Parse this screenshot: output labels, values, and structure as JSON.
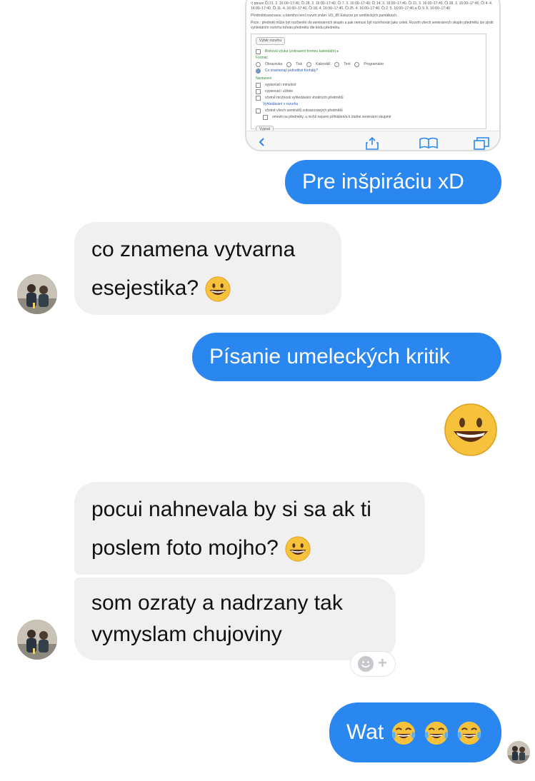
{
  "shared_image": {
    "line1": "¹) pouze Čt 21. 2. 16:00–17:40, Čt 28. 2. 16:00–17:40, Čt 7. 3. 16:00–17:40, Čt 14. 3. 16:00–17:40, Čt 21. 3. 16:00–17:40, Čt 28. 3. 16:00–17:40, Čt 4. 4. 16:00–17:40, Čt 11. 4. 16:00–17:40, Čt 18. 4. 16:00–17:40, Čt 25. 4. 16:00–17:40, Čt 2. 5. 16:00–17:40 a Čt 9. 5. 16:00–17:40",
    "line2": "Předmět/rezervace, u kterého není rozvrh znám: US_85 Exkurze po uměleckých památkách.",
    "line3": "Pozn.: předmět může být rozčleněn do seminárních skupin a pak nemusí být rozvrhován jako celek. Rozvrh všech seminárních skupin předmětu lze zjistit vyhledáním rozvrhu tohoto předmětu dle kódu předmětu.",
    "select_button": "Výběr rozvrhu",
    "block_view": "Bloková výuka (zobrazení formou kalendáře) ▸",
    "format_label": "Formát:",
    "formats": [
      "Obrazovka",
      "Tisk",
      "Kalendář",
      "Text",
      "Programátor"
    ],
    "help_link": "Co znamenají jednotlivé formáty?",
    "settings_label": "Nastavení",
    "options": [
      "vypisovat i minulost",
      "vypisovat i učitele",
      "včetně možnosti vyhledávání vhodných předmětů",
      "Vyhledávání v rozvrhu",
      "včetně všech seminářů zobrazovaných předmětů",
      "omezit na předměty, u nichž nejsem přihlášen/a k žádné seminární skupině"
    ],
    "submit_button": "Vypsat"
  },
  "messages": {
    "m1": "Pre inšpiráciu xD",
    "m2_line1": "co znamena vytvarna",
    "m2_line2": "esejestika?",
    "m3": "Písanie umeleckých kritik",
    "m5_line1": "pocui nahnevala by si sa ak ti",
    "m5_line2": "poslem foto mojho?",
    "m6_line1": "som ozraty a nadrzany tak",
    "m6_line2": "vymyslam chujoviny",
    "m7": "Wat"
  },
  "reaction_button_plus": "+",
  "colors": {
    "outgoing": "#2b87f0",
    "incoming": "#f0f0f0",
    "emoji_yellow": "#f6c23b"
  }
}
